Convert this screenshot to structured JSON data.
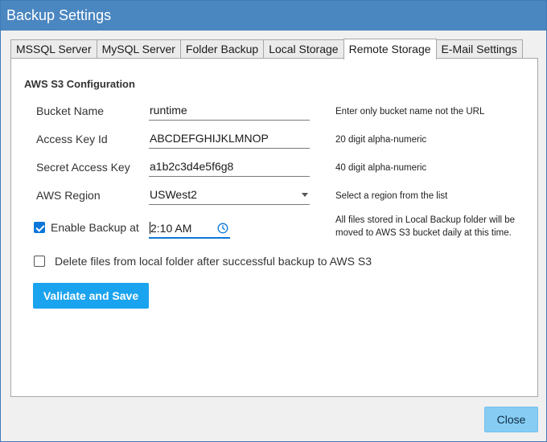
{
  "window": {
    "title": "Backup Settings"
  },
  "tabs": [
    {
      "label": "MSSQL Server"
    },
    {
      "label": "MySQL Server"
    },
    {
      "label": "Folder Backup"
    },
    {
      "label": "Local Storage"
    },
    {
      "label": "Remote Storage",
      "active": true
    },
    {
      "label": "E-Mail Settings"
    }
  ],
  "s3": {
    "section_title": "AWS S3 Configuration",
    "bucket": {
      "label": "Bucket Name",
      "value": "runtime",
      "hint": "Enter only bucket name not the URL"
    },
    "access_key": {
      "label": "Access Key Id",
      "value": "ABCDEFGHIJKLMNOP",
      "hint": "20 digit alpha-numeric"
    },
    "secret_key": {
      "label": "Secret Access Key",
      "value": "a1b2c3d4e5f6g8",
      "hint": "40 digit alpha-numeric"
    },
    "region": {
      "label": "AWS Region",
      "value": "USWest2",
      "hint": "Select a region from the list"
    },
    "schedule": {
      "label": "Enable Backup at",
      "checked": true,
      "time": "2:10 AM",
      "hint_line1": "All files stored in Local Backup folder will be",
      "hint_line2": "moved to AWS S3 bucket daily at this time."
    },
    "delete_local": {
      "label": "Delete files from local folder after successful backup to AWS S3",
      "checked": false
    },
    "validate_button": "Validate and Save"
  },
  "footer": {
    "close_button": "Close"
  },
  "colors": {
    "titlebar": "#4a86c0",
    "accent": "#0a77d9",
    "primary_button": "#1aa3ee",
    "close_button": "#87cdf3"
  }
}
